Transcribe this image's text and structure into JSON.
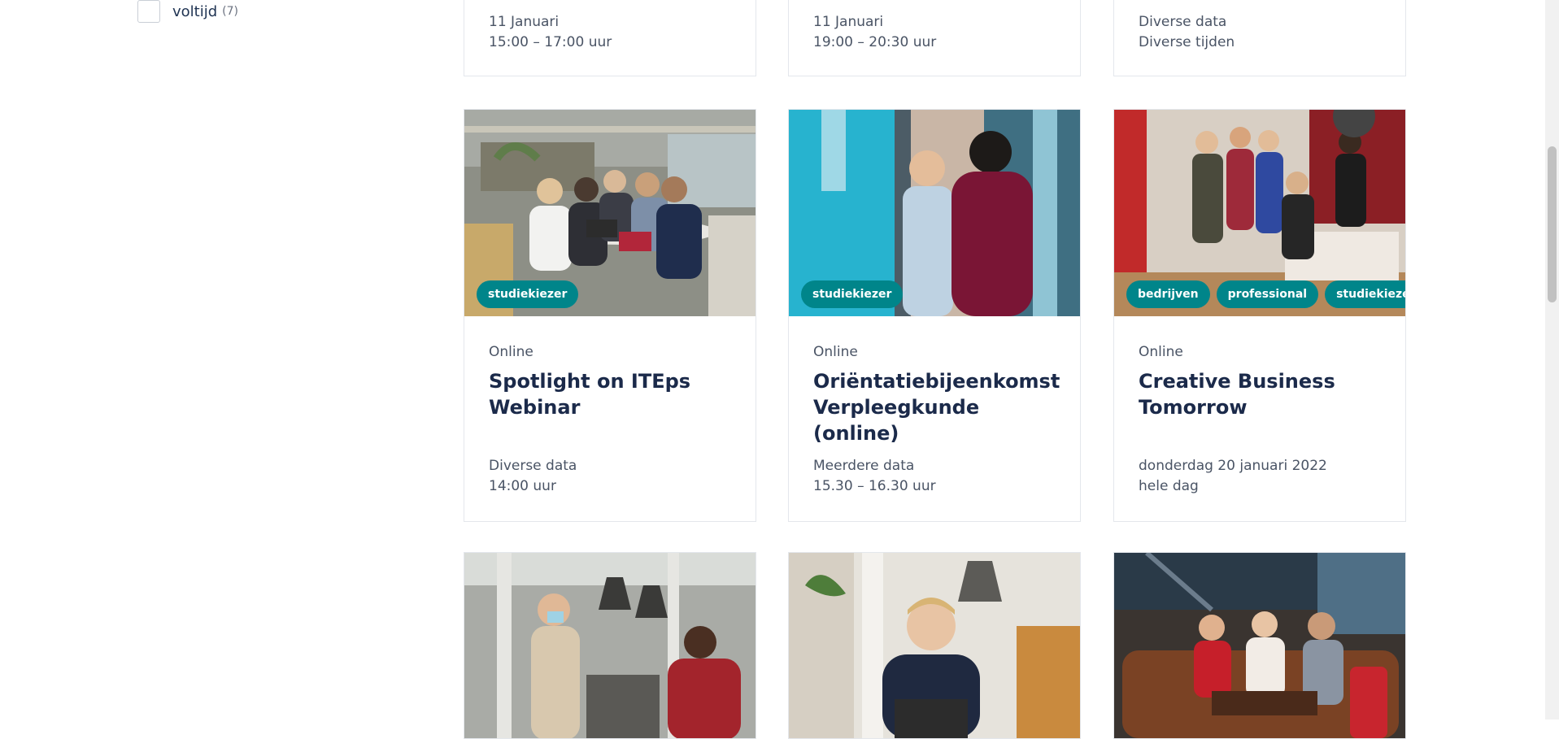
{
  "filter": {
    "label": "voltijd",
    "count": "(7)"
  },
  "top_cards": [
    {
      "date": "11 Januari",
      "time": "15:00 – 17:00 uur"
    },
    {
      "date": "11 Januari",
      "time": "19:00 – 20:30 uur"
    },
    {
      "date": "Diverse data",
      "time": "Diverse tijden"
    }
  ],
  "cards": [
    {
      "tags": [
        "studiekiezer"
      ],
      "type": "Online",
      "title": "Spotlight on ITEps Webinar",
      "date": "Diverse data",
      "time": "14:00 uur"
    },
    {
      "tags": [
        "studiekiezer"
      ],
      "type": "Online",
      "title": "Oriëntatiebijeenkomst Verpleegkunde (online)",
      "date": "Meerdere data",
      "time": "15.30 – 16.30 uur"
    },
    {
      "tags": [
        "bedrijven",
        "professional",
        "studiekiezer"
      ],
      "type": "Online",
      "title": "Creative Business Tomorrow",
      "date": "donderdag 20 januari 2022",
      "time": "hele dag"
    }
  ],
  "colors": {
    "tag_bg": "#00858a",
    "title": "#1b2a4a",
    "border": "#e4e7ec"
  },
  "images": [
    "students-at-table-photo",
    "student-greeting-photo",
    "group-portrait-photo",
    "students-hallway-photo",
    "student-laptop-photo",
    "students-sofa-photo"
  ]
}
